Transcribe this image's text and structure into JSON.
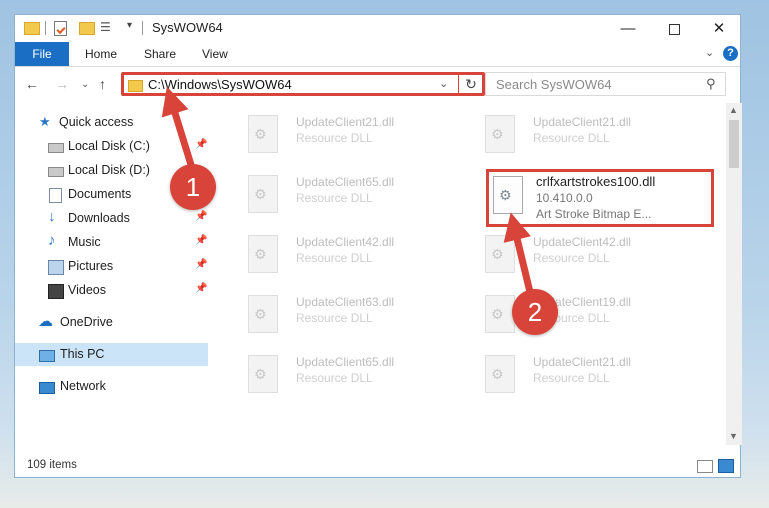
{
  "window": {
    "title": "SysWOW64",
    "minimize": "—",
    "close": "✕"
  },
  "ribbon": {
    "tabs": [
      "File",
      "Home",
      "Share",
      "View"
    ],
    "chevron": "⌄",
    "help": "?"
  },
  "address": {
    "path": "C:\\Windows\\SysWOW64",
    "refresh": "↻",
    "dropdown": "⌄"
  },
  "search": {
    "placeholder": "Search SysWOW64",
    "icon": "search-icon"
  },
  "nav": {
    "back": "←",
    "forward": "→",
    "recent": "⌄",
    "up": "↑"
  },
  "sidebar": {
    "items": [
      {
        "label": "Quick access",
        "icon": "star-icon"
      },
      {
        "label": "Local Disk (C:)",
        "icon": "disk-icon",
        "pinned": true
      },
      {
        "label": "Local Disk (D:)",
        "icon": "disk-icon"
      },
      {
        "label": "Documents",
        "icon": "documents-icon",
        "pinned": true
      },
      {
        "label": "Downloads",
        "icon": "download-icon",
        "pinned": true
      },
      {
        "label": "Music",
        "icon": "music-icon",
        "pinned": true
      },
      {
        "label": "Pictures",
        "icon": "pictures-icon",
        "pinned": true
      },
      {
        "label": "Videos",
        "icon": "videos-icon",
        "pinned": true
      },
      {
        "label": "OneDrive",
        "icon": "cloud-icon"
      },
      {
        "label": "This PC",
        "icon": "pc-icon",
        "selected": true
      },
      {
        "label": "Network",
        "icon": "network-icon"
      }
    ]
  },
  "files": {
    "left": [
      {
        "name": "UpdateClient21.dll",
        "desc": "Resource DLL"
      },
      {
        "name": "UpdateClient65.dll",
        "desc": "Resource DLL"
      },
      {
        "name": "UpdateClient42.dll",
        "desc": "Resource DLL"
      },
      {
        "name": "UpdateClient63.dll",
        "desc": "Resource DLL"
      },
      {
        "name": "UpdateClient65.dll",
        "desc": "Resource DLL"
      }
    ],
    "right": [
      {
        "name": "UpdateClient21.dll",
        "desc": "Resource DLL"
      },
      {
        "name": "UpdateClient42.dll",
        "desc": "Resource DLL"
      },
      {
        "name": "UpdateClient19.dll",
        "desc": "Resource DLL"
      },
      {
        "name": "UpdateClient21.dll",
        "desc": "Resource DLL"
      }
    ],
    "highlight": {
      "name": "crlfxartstrokes100.dll",
      "version": "10.410.0.0",
      "desc": "Art Stroke Bitmap E..."
    }
  },
  "status": {
    "count": "109 items"
  },
  "annotations": {
    "marker1": "1",
    "marker2": "2",
    "color": "#d9443a"
  },
  "colors": {
    "accent": "#1a6fc4",
    "selection": "#cce4f7",
    "annotation": "#d9443a"
  }
}
